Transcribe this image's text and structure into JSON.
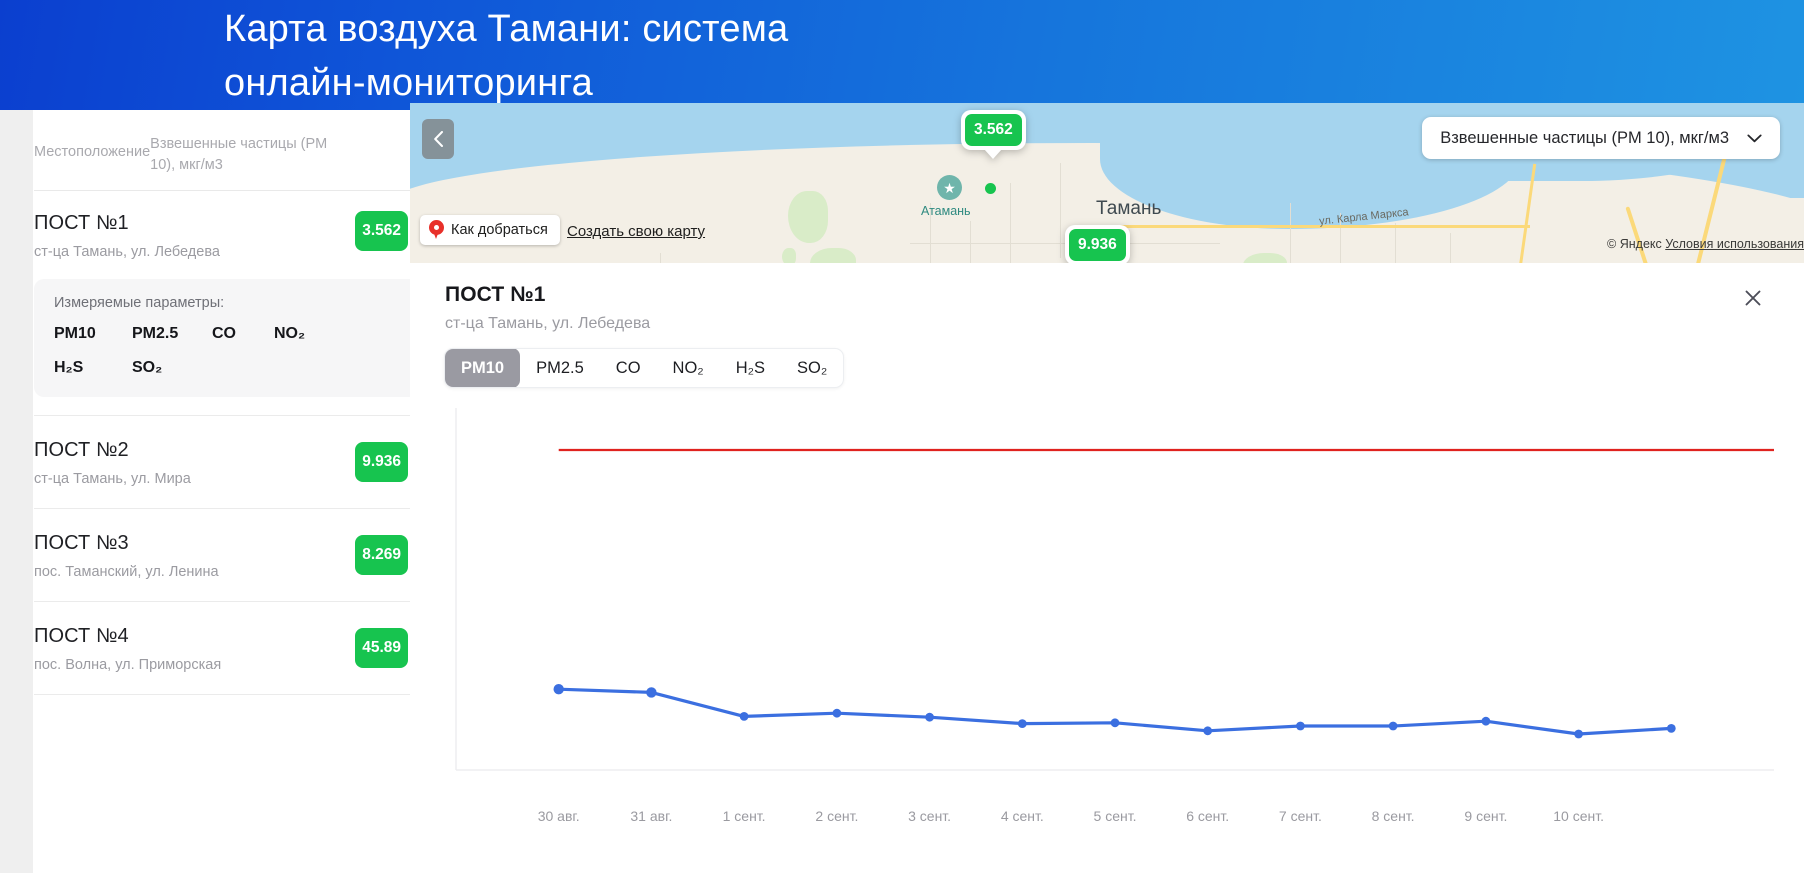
{
  "header": {
    "title": "Карта воздуха Тамани: система\nонлайн-мониторинга"
  },
  "sidebar": {
    "col_location": "Местоположение",
    "col_param": "Взвешенные частицы (PM 10), мкг/м3",
    "posts": [
      {
        "name": "ПОСТ №1",
        "address": "ст-ца Тамань, ул. Лебедева",
        "value": "3.562",
        "color": "#17c44f"
      },
      {
        "name": "ПОСТ №2",
        "address": "ст-ца Тамань, ул. Мира",
        "value": "9.936",
        "color": "#17c44f"
      },
      {
        "name": "ПОСТ №3",
        "address": "пос. Таманский, ул. Ленина",
        "value": "8.269",
        "color": "#17c44f"
      },
      {
        "name": "ПОСТ №4",
        "address": "пос. Волна, ул. Приморская",
        "value": "45.89",
        "color": "#17c44f"
      }
    ],
    "params_card": {
      "title": "Измеряемые параметры:",
      "items": [
        "PM10",
        "PM2.5",
        "CO",
        "NO₂",
        "H₂S",
        "SO₂"
      ]
    }
  },
  "map": {
    "selector_value": "Взвешенные частицы (PM 10), мкг/м3",
    "selector_chevron": "chevron-down-icon",
    "collapse_icon": "chevron-left-icon",
    "howto_label": "Как добраться",
    "create_map_label": "Создать свою карту",
    "copyright_prefix": "© Яндекс",
    "copyright_terms": "Условия использования",
    "labels": {
      "taman": "Тамань",
      "ataman": "Атамань",
      "street": "ул. Карла Маркса"
    },
    "markers": [
      {
        "value": "3.562",
        "color": "#17c44f"
      },
      {
        "value": "9.936",
        "color": "#17c44f"
      }
    ]
  },
  "panel": {
    "title": "ПОСТ №1",
    "subtitle": "ст-ца Тамань, ул. Лебедева",
    "close_icon": "close-icon",
    "tabs": [
      {
        "label": "PM10",
        "active": true
      },
      {
        "label": "PM2.5",
        "active": false
      },
      {
        "label": "CO",
        "active": false
      },
      {
        "label": "NO₂",
        "active": false
      },
      {
        "label": "H₂S",
        "active": false
      },
      {
        "label": "SO₂",
        "active": false
      }
    ]
  },
  "chart_data": {
    "type": "line",
    "title": "",
    "xlabel": "",
    "ylabel": "",
    "categories": [
      "30 авг.",
      "31 авг.",
      "1 сент.",
      "2 сент.",
      "3 сент.",
      "4 сент.",
      "5 сент.",
      "6 сент.",
      "7 сент.",
      "8 сент.",
      "9 сент.",
      "10 сент."
    ],
    "series": [
      {
        "name": "PM10",
        "color": "#3b6fe0",
        "values": [
          5.05,
          4.85,
          3.35,
          3.55,
          3.3,
          2.9,
          2.95,
          2.45,
          2.75,
          2.75,
          3.05,
          2.25
        ]
      }
    ],
    "extra_point": {
      "x": 13,
      "value": 2.6
    },
    "threshold": {
      "value": 20.0,
      "color": "#e0231f",
      "label": ""
    },
    "ylim": [
      0,
      21.5
    ],
    "grid": false,
    "legend": false
  }
}
